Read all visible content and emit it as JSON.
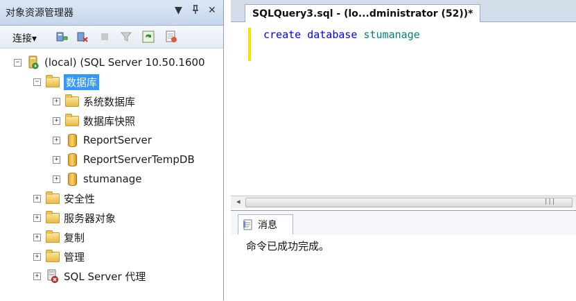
{
  "object_explorer": {
    "title": "对象资源管理器",
    "title_controls": [
      "▼",
      "ᵖ",
      "✕"
    ],
    "toolbar": {
      "connect_label": "连接▾",
      "icons": [
        "connect-server-icon",
        "disconnect-icon",
        "stop-icon",
        "filter-icon",
        "refresh-icon",
        "new-query-icon"
      ]
    },
    "tree": [
      {
        "label": "(local) (SQL Server 10.50.1600",
        "icon": "server-icon",
        "expanded": true,
        "level": 0
      },
      {
        "label": "数据库",
        "icon": "folder-icon",
        "expanded": true,
        "level": 1,
        "selected": true
      },
      {
        "label": "系统数据库",
        "icon": "folder-icon",
        "expanded": false,
        "level": 2
      },
      {
        "label": "数据库快照",
        "icon": "folder-icon",
        "expanded": false,
        "level": 2
      },
      {
        "label": "ReportServer",
        "icon": "database-icon",
        "expanded": false,
        "level": 2
      },
      {
        "label": "ReportServerTempDB",
        "icon": "database-icon",
        "expanded": false,
        "level": 2
      },
      {
        "label": "stumanage",
        "icon": "database-icon",
        "expanded": false,
        "level": 2
      },
      {
        "label": "安全性",
        "icon": "folder-icon",
        "expanded": false,
        "level": 1
      },
      {
        "label": "服务器对象",
        "icon": "folder-icon",
        "expanded": false,
        "level": 1
      },
      {
        "label": "复制",
        "icon": "folder-icon",
        "expanded": false,
        "level": 1
      },
      {
        "label": "管理",
        "icon": "folder-icon",
        "expanded": false,
        "level": 1
      },
      {
        "label": "SQL Server 代理",
        "icon": "sql-agent-icon",
        "expanded": false,
        "level": 1
      }
    ]
  },
  "query_editor": {
    "tab_title": "SQLQuery3.sql - (lo...dministrator (52))*",
    "code": {
      "kw1": "create",
      "kw2": "database",
      "ident": "stumanage"
    }
  },
  "messages": {
    "tab_label": "消息",
    "text": "命令已成功完成。"
  },
  "colors": {
    "keyword": "#0000ff",
    "identifier": "#008080",
    "selection": "#3399ff"
  }
}
